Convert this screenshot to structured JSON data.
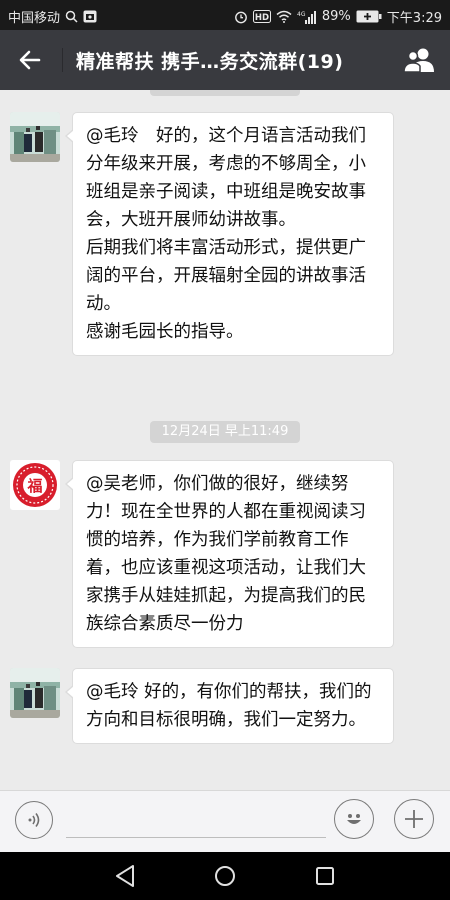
{
  "status_bar": {
    "carrier": "中国移动",
    "network": "4G",
    "battery": "89%",
    "time": "下午3:29"
  },
  "header": {
    "back_icon": "back-arrow-icon",
    "title": "精准帮扶  携手…务交流群(19)",
    "members_icon": "group-members-icon"
  },
  "messages": [
    {
      "avatar": "user-photo-avatar",
      "paragraphs": [
        "@毛玲　好的，这个月语言活动我们分年级来开展，考虑的不够周全，小班组是亲子阅读，中班组是晚安故事会，大班开展师幼讲故事。",
        "后期我们将丰富活动形式，提供更广阔的平台，开展辐射全园的讲故事活动。",
        "感谢毛园长的指导。"
      ]
    },
    {
      "avatar": "fu-character-avatar",
      "paragraphs": [
        "@吴老师，你们做的很好，继续努力！现在全世界的人都在重视阅读习惯的培养，作为我们学前教育工作着，也应该重视这项活动，让我们大家携手从娃娃抓起，为提高我们的民族综合素质尽一份力"
      ]
    },
    {
      "avatar": "user-photo-avatar",
      "paragraphs": [
        "@毛玲 好的，有你们的帮扶，我们的方向和目标很明确，我们一定努力。"
      ]
    }
  ],
  "timestamps": [
    "12月24日 早上11:49"
  ],
  "avatar_fu_char": "福",
  "input_bar": {
    "voice_icon": "voice-input-icon",
    "text_value": "",
    "emoji_icon": "emoji-icon",
    "plus_icon": "plus-icon"
  },
  "nav_bar": {
    "back_icon": "nav-back-icon",
    "home_icon": "nav-home-icon",
    "recents_icon": "nav-recents-icon"
  },
  "colors": {
    "title_bar": "#393a3f",
    "chat_background": "#ebebeb",
    "bubble": "#ffffff",
    "timestamp_pill": "#d4d4d4",
    "fu_avatar_red": "#d81e2c"
  }
}
